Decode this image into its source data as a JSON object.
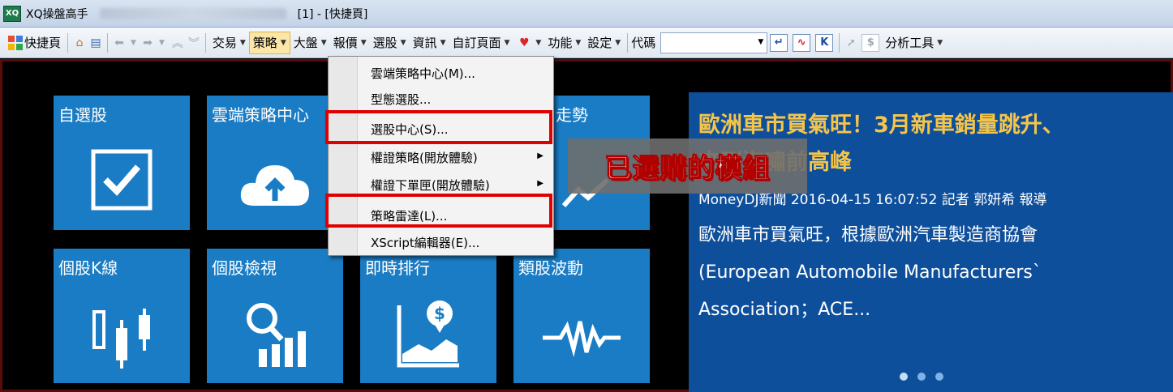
{
  "titlebar": {
    "app_logo": "XQ",
    "app_name": "XQ操盤高手",
    "window_title": "[1] - [快捷頁]"
  },
  "toolbar": {
    "quick_page": "快捷頁",
    "menus": [
      "交易",
      "策略",
      "大盤",
      "報價",
      "選股",
      "資訊",
      "自訂頁面"
    ],
    "menus2": [
      "功能",
      "設定"
    ],
    "code_label": "代碼",
    "analysis_tools": "分析工具",
    "k_button": "K",
    "dollar_button": "$"
  },
  "tiles": {
    "watchlist": "自選股",
    "cloud_strategy": "雲端策略中心",
    "trend": "走勢",
    "kline": "個股K線",
    "stock_view": "個股檢視",
    "realtime_rank": "即時排行",
    "sector_volatility": "類股波動",
    "dollar_sign": "$"
  },
  "news": {
    "title": "歐洲車市買氣旺！3月新車銷量跳升、",
    "title_line2": "來到海嘯前高峰",
    "meta": "MoneyDJ新聞 2016-04-15 16:07:52 記者 郭妍希 報導",
    "body_line1": "歐洲車市買氣旺，根據歐洲汽車製造商協會",
    "body_line2": "(European Automobile Manufacturers`",
    "body_line3": "Association；ACE..."
  },
  "strategy_menu": {
    "items": [
      "雲端策略中心(M)...",
      "型態選股...",
      "選股中心(S)...",
      "權證策略(開放體驗)",
      "權證下單匣(開放體驗)",
      "策略雷達(L)...",
      "XScript編輯器(E)..."
    ]
  },
  "annotation": "已選購的模組",
  "colors": {
    "tile_blue": "#1a7cc4",
    "news_bg": "#0e4f9c",
    "news_title": "#f5c54a",
    "highlight_red": "#e00000"
  }
}
